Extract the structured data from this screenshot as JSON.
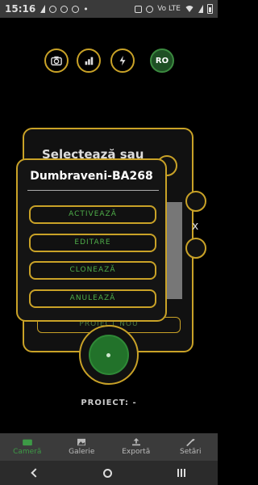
{
  "status": {
    "time": "15:16",
    "right_text": "Vo LTE"
  },
  "toolbar": {
    "lang_button": "RO"
  },
  "background_panel": {
    "title_line1": "Selectează sau",
    "proiect_nou": "PROIECT NOU",
    "x": "x"
  },
  "dialog": {
    "title": "Dumbraveni-BA268",
    "buttons": [
      "ACTIVEAZĂ",
      "EDITARE",
      "CLONEAZĂ",
      "ANULEAZĂ"
    ]
  },
  "project_label": "PROIECT: -",
  "bottom_nav": {
    "items": [
      {
        "label": "Cameră",
        "icon": "camera-icon",
        "active": true
      },
      {
        "label": "Galerie",
        "icon": "gallery-icon",
        "active": false
      },
      {
        "label": "Exportă",
        "icon": "export-icon",
        "active": false
      },
      {
        "label": "Setări",
        "icon": "settings-icon",
        "active": false
      }
    ]
  },
  "colors": {
    "accent": "#c9a227",
    "green": "#4fae4a",
    "dark_green": "#1e4f24"
  }
}
